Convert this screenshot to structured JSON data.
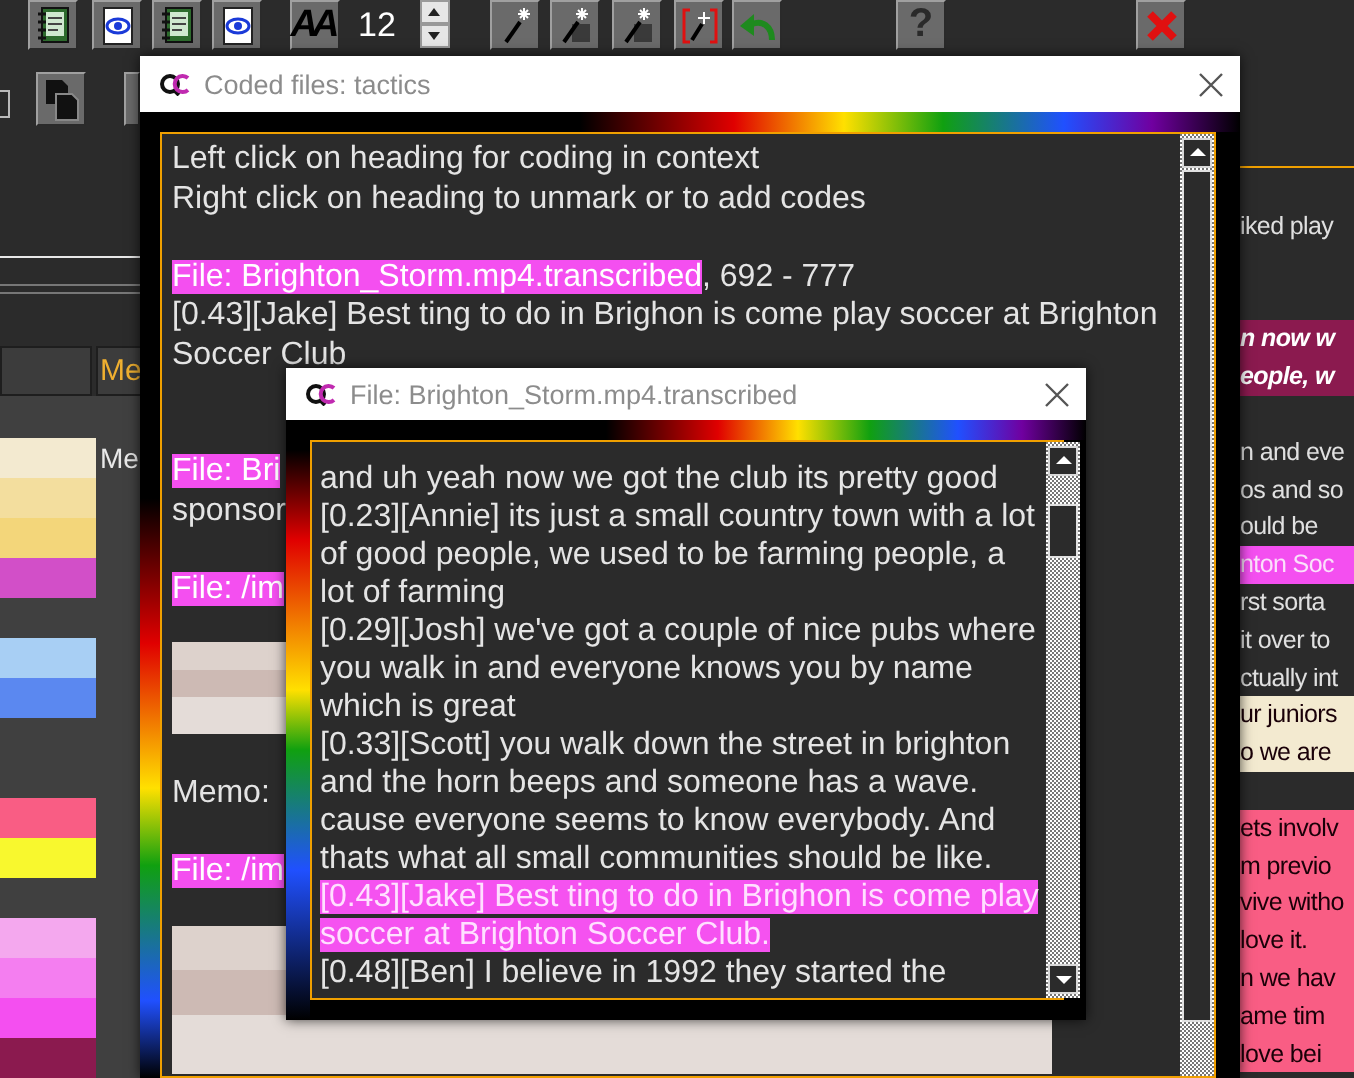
{
  "toolbar": {
    "font_button": {
      "label": "AA"
    },
    "font_size": {
      "value": "12"
    },
    "help_button": {
      "label": "?"
    }
  },
  "side_panel": {
    "tab": {
      "label": "Me"
    },
    "rows": [
      {
        "kind": "swatch",
        "color": "#f3ead0",
        "label": "Me"
      },
      {
        "kind": "swatch",
        "color": "#f3de9e"
      },
      {
        "kind": "swatch",
        "color": "#f3d67a"
      },
      {
        "kind": "swatch",
        "color": "#d24fc8"
      },
      {
        "kind": "empty"
      },
      {
        "kind": "swatch",
        "color": "#a8cff4"
      },
      {
        "kind": "swatch",
        "color": "#5b88f0"
      },
      {
        "kind": "empty"
      },
      {
        "kind": "empty"
      },
      {
        "kind": "swatch",
        "color": "#f95d84"
      },
      {
        "kind": "swatch",
        "color": "#f8f82e"
      },
      {
        "kind": "empty"
      },
      {
        "kind": "swatch",
        "color": "#f4a8ee"
      },
      {
        "kind": "swatch",
        "color": "#f47ef0"
      },
      {
        "kind": "swatch",
        "color": "#f44ff0"
      },
      {
        "kind": "swatch",
        "color": "#8b1a4f"
      }
    ]
  },
  "background_pane": {
    "lines": [
      {
        "kind": "plain",
        "text": "iked play"
      },
      {
        "kind": "gap"
      },
      {
        "kind": "gap"
      },
      {
        "kind": "emphasis",
        "text": "n now w",
        "color": "#8b1a4f"
      },
      {
        "kind": "emphasis",
        "text": "eople, w",
        "color": "#8b1a4f"
      },
      {
        "kind": "gap"
      },
      {
        "kind": "plain",
        "text": "n and eve"
      },
      {
        "kind": "plain",
        "text": "os and so"
      },
      {
        "kind": "plain",
        "text": "ould be"
      },
      {
        "kind": "coded",
        "text": "nton Soc",
        "color": "#f44ff0"
      },
      {
        "kind": "plain",
        "text": "rst sorta"
      },
      {
        "kind": "plain",
        "text": "it over to"
      },
      {
        "kind": "plain",
        "text": "ctually int"
      },
      {
        "kind": "coded-dark",
        "text": "ur juniors",
        "color": "#f3ead0"
      },
      {
        "kind": "coded-dark",
        "text": "o we are",
        "color": "#f3ead0"
      },
      {
        "kind": "gap"
      },
      {
        "kind": "coded-dark",
        "text": "ets involv",
        "color": "#f95d84"
      },
      {
        "kind": "coded-dark",
        "text": "m previo",
        "color": "#f95d84"
      },
      {
        "kind": "coded-dark",
        "text": "vive witho",
        "color": "#f95d84"
      },
      {
        "kind": "coded-dark",
        "text": "love it.",
        "color": "#f95d84"
      },
      {
        "kind": "coded-dark",
        "text": "n we hav",
        "color": "#f95d84"
      },
      {
        "kind": "coded-dark",
        "text": "ame tim",
        "color": "#f95d84"
      },
      {
        "kind": "coded-dark",
        "text": "love bei",
        "color": "#f95d84"
      }
    ]
  },
  "main_window": {
    "title": "Coded files: tactics",
    "content": [
      {
        "kind": "text",
        "text": "Left click on heading for coding in context"
      },
      {
        "kind": "text",
        "text": "Right click on heading to unmark or to add codes"
      },
      {
        "kind": "gap"
      },
      {
        "kind": "heading",
        "text": "File: Brighton_Storm.mp4.transcribed",
        "suffix": ", 692 - 777"
      },
      {
        "kind": "text",
        "text": "[0.43][Jake] Best ting to do in Brighon is come play soccer at Brighton"
      },
      {
        "kind": "text",
        "text": "Soccer Club"
      },
      {
        "kind": "gap"
      },
      {
        "kind": "gap"
      },
      {
        "kind": "heading",
        "text": "File: Bri"
      },
      {
        "kind": "text",
        "text": "sponsor"
      },
      {
        "kind": "gap"
      },
      {
        "kind": "heading",
        "text": "File: /im"
      },
      {
        "kind": "photo"
      },
      {
        "kind": "text",
        "text": "Memo:"
      },
      {
        "kind": "gap"
      },
      {
        "kind": "heading",
        "text": "File: /im"
      },
      {
        "kind": "photo"
      }
    ]
  },
  "popup_window": {
    "title": "File: Brighton_Storm.mp4.transcribed",
    "lines": [
      {
        "text": "and uh yeah now we got the club its pretty good",
        "coded": false
      },
      {
        "text": "[0.23][Annie] its just a small country town with a lot",
        "coded": false
      },
      {
        "text": "of good people, we used to be farming people, a",
        "coded": false
      },
      {
        "text": "lot of farming",
        "coded": false
      },
      {
        "text": "[0.29][Josh] we've got a couple of nice pubs where",
        "coded": false
      },
      {
        "text": "you walk in and everyone knows you by name",
        "coded": false
      },
      {
        "text": "which is great",
        "coded": false
      },
      {
        "text": "[0.33][Scott] you walk down the street in brighton",
        "coded": false
      },
      {
        "text": "and the horn beeps and someone has a wave.",
        "coded": false
      },
      {
        "text": "cause everyone seems to know everybody. And",
        "coded": false
      },
      {
        "text": "thats what all small communities should be like.",
        "coded": false
      },
      {
        "text": "[0.43][Jake] Best ting to do in Brighon is come play",
        "coded": true
      },
      {
        "text": "soccer at Brighton Soccer Club.",
        "coded": true
      },
      {
        "text": "[0.48][Ben] I believe in 1992 they started the",
        "coded": false
      }
    ]
  }
}
